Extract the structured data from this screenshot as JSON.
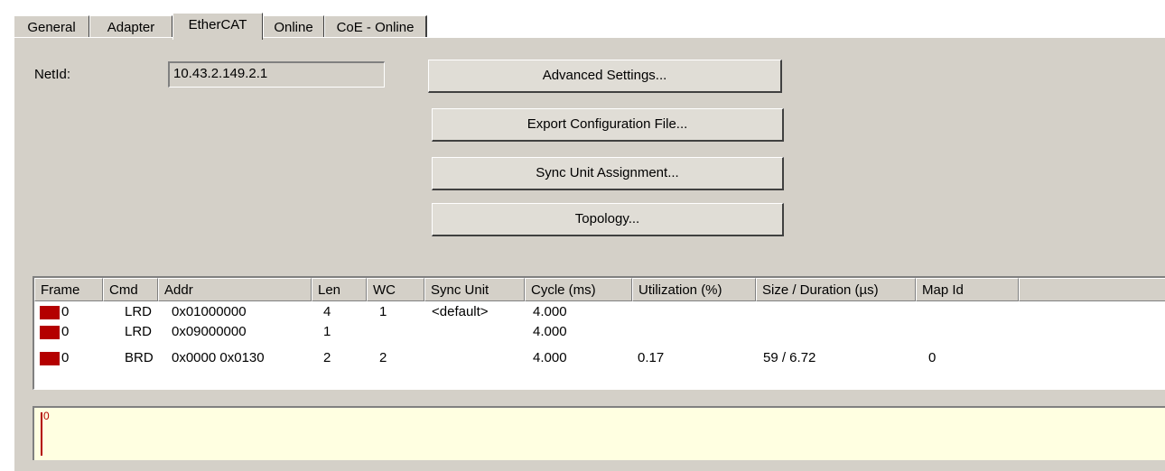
{
  "tabs": [
    "General",
    "Adapter",
    "EtherCAT",
    "Online",
    "CoE - Online"
  ],
  "active_tab": "EtherCAT",
  "netid": {
    "label": "NetId:",
    "value": "10.43.2.149.2.1"
  },
  "buttons": {
    "advanced": "Advanced Settings...",
    "export": "Export Configuration File...",
    "sync": "Sync Unit Assignment...",
    "topology": "Topology..."
  },
  "table": {
    "headers": [
      "Frame",
      "Cmd",
      "Addr",
      "Len",
      "WC",
      "Sync Unit",
      "Cycle (ms)",
      "Utilization (%)",
      "Size / Duration (µs)",
      "Map Id"
    ],
    "rows": [
      [
        "0",
        "LRD",
        "0x01000000",
        "4",
        "1",
        "<default>",
        "4.000",
        "",
        "",
        ""
      ],
      [
        "0",
        "LRD",
        "0x09000000",
        "1",
        "",
        "",
        "4.000",
        "",
        "",
        ""
      ],
      [
        "0",
        "BRD",
        "0x0000 0x0130",
        "2",
        "2",
        "",
        "4.000",
        "0.17",
        "59 / 6.72",
        "0"
      ]
    ],
    "frame_icon_color": "#b40000"
  },
  "log": {
    "text": "0"
  }
}
